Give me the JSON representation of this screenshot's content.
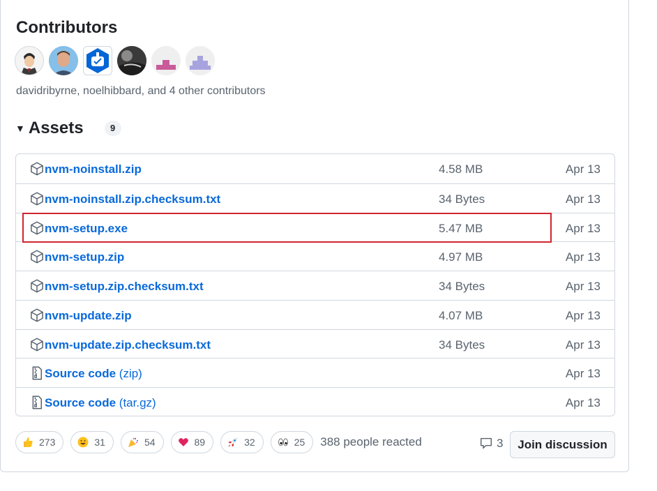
{
  "contributors": {
    "title": "Contributors",
    "summary": "davidribyrne, noelhibbard, and 4 other contributors",
    "avatars": [
      "davidribyrne",
      "noelhibbard",
      "dependabot",
      "contributor-4",
      "contributor-5",
      "contributor-6"
    ]
  },
  "assets": {
    "title": "Assets",
    "count": "9",
    "items": [
      {
        "name": "nvm-noinstall.zip",
        "size": "4.58 MB",
        "date": "Apr 13",
        "icon": "package-icon"
      },
      {
        "name": "nvm-noinstall.zip.checksum.txt",
        "size": "34 Bytes",
        "date": "Apr 13",
        "icon": "package-icon"
      },
      {
        "name": "nvm-setup.exe",
        "size": "5.47 MB",
        "date": "Apr 13",
        "icon": "package-icon"
      },
      {
        "name": "nvm-setup.zip",
        "size": "4.97 MB",
        "date": "Apr 13",
        "icon": "package-icon"
      },
      {
        "name": "nvm-setup.zip.checksum.txt",
        "size": "34 Bytes",
        "date": "Apr 13",
        "icon": "package-icon"
      },
      {
        "name": "nvm-update.zip",
        "size": "4.07 MB",
        "date": "Apr 13",
        "icon": "package-icon"
      },
      {
        "name": "nvm-update.zip.checksum.txt",
        "size": "34 Bytes",
        "date": "Apr 13",
        "icon": "package-icon"
      },
      {
        "name": "Source code",
        "sub": "(zip)",
        "size": "",
        "date": "Apr 13",
        "icon": "file-zip-icon"
      },
      {
        "name": "Source code",
        "sub": "(tar.gz)",
        "size": "",
        "date": "Apr 13",
        "icon": "file-zip-icon"
      }
    ]
  },
  "reactions": {
    "items": [
      {
        "emoji": "thumbs-up-icon",
        "count": "273"
      },
      {
        "emoji": "smile-icon",
        "count": "31"
      },
      {
        "emoji": "tada-icon",
        "count": "54"
      },
      {
        "emoji": "heart-icon",
        "count": "89"
      },
      {
        "emoji": "rocket-icon",
        "count": "32"
      },
      {
        "emoji": "eyes-icon",
        "count": "25"
      }
    ],
    "summary": "388 people reacted"
  },
  "discussion": {
    "comment_count": "3",
    "join_label": "Join discussion"
  },
  "colors": {
    "link": "#0969da",
    "muted": "#59636e",
    "highlight": "#d1242f",
    "border": "#d0d7de"
  }
}
